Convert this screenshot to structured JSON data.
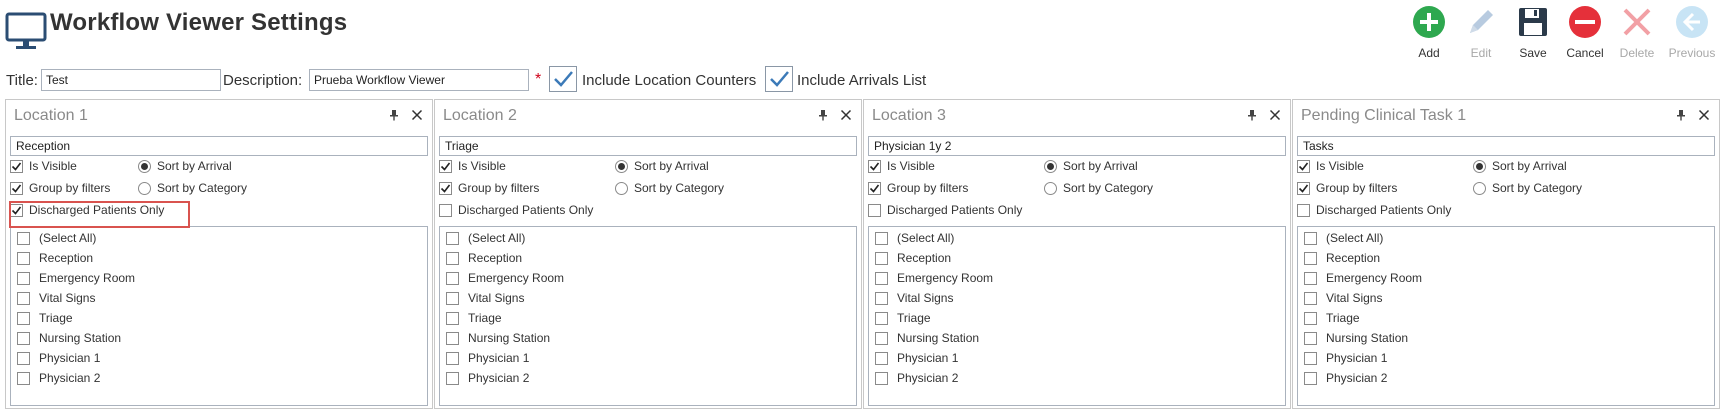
{
  "header": {
    "title": "Workflow Viewer Settings"
  },
  "toolbar": {
    "add": "Add",
    "edit": "Edit",
    "save": "Save",
    "cancel": "Cancel",
    "delete": "Delete",
    "previous": "Previous"
  },
  "colors": {
    "add": "#2ea84f",
    "cancel": "#e5303a",
    "disabled": "#b8cbe0",
    "save": "#2b3a4a",
    "highlight": "#d9534f"
  },
  "form": {
    "title_label": "Title:",
    "title_value": "Test",
    "description_label": "Description:",
    "description_value": "Prueba Workflow Viewer",
    "required_marker": "*",
    "include_location_counters": "Include Location Counters",
    "include_arrivals_list": "Include Arrivals List"
  },
  "panels": [
    {
      "title": "Location 1",
      "name": "Reception",
      "is_visible_label": "Is Visible",
      "group_label": "Group by filters",
      "discharged_label": "Discharged Patients Only",
      "sort_arrival_label": "Sort by Arrival",
      "sort_category_label": "Sort by Category",
      "is_visible": true,
      "group_by_filters": true,
      "discharged_only": true,
      "sort": "arrival",
      "items": [
        "(Select All)",
        "Reception",
        "Emergency Room",
        "Vital Signs",
        "Triage",
        "Nursing Station",
        "Physician 1",
        "Physician 2"
      ]
    },
    {
      "title": "Location 2",
      "name": "Triage",
      "is_visible_label": "Is Visible",
      "group_label": "Group by filters",
      "discharged_label": "Discharged Patients Only",
      "sort_arrival_label": "Sort by Arrival",
      "sort_category_label": "Sort by Category",
      "is_visible": true,
      "group_by_filters": true,
      "discharged_only": false,
      "sort": "arrival",
      "items": [
        "(Select All)",
        "Reception",
        "Emergency Room",
        "Vital Signs",
        "Triage",
        "Nursing Station",
        "Physician 1",
        "Physician 2"
      ]
    },
    {
      "title": "Location 3",
      "name": "Physician 1y 2",
      "is_visible_label": "Is Visible",
      "group_label": "Group by filters",
      "discharged_label": "Discharged Patients Only",
      "sort_arrival_label": "Sort by Arrival",
      "sort_category_label": "Sort by Category",
      "is_visible": true,
      "group_by_filters": true,
      "discharged_only": false,
      "sort": "arrival",
      "items": [
        "(Select All)",
        "Reception",
        "Emergency Room",
        "Vital Signs",
        "Triage",
        "Nursing Station",
        "Physician 1",
        "Physician 2"
      ]
    },
    {
      "title": "Pending Clinical Task 1",
      "name": "Tasks",
      "is_visible_label": "Is Visible",
      "group_label": "Group by filters",
      "discharged_label": "Discharged Patients Only",
      "sort_arrival_label": "Sort by Arrival",
      "sort_category_label": "Sort by Category",
      "is_visible": true,
      "group_by_filters": true,
      "discharged_only": false,
      "sort": "arrival",
      "items": [
        "(Select All)",
        "Reception",
        "Emergency Room",
        "Vital Signs",
        "Triage",
        "Nursing Station",
        "Physician 1",
        "Physician 2"
      ]
    }
  ]
}
